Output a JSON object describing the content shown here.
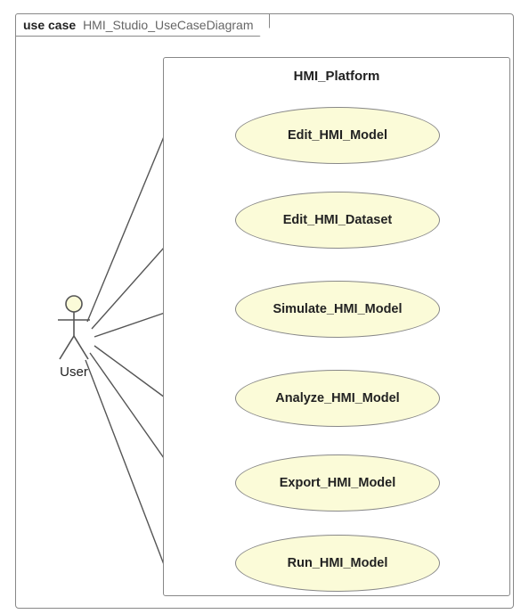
{
  "frame": {
    "keyword": "use case",
    "name": "HMI_Studio_UseCaseDiagram"
  },
  "system": {
    "name": "HMI_Platform"
  },
  "actor": {
    "name": "User"
  },
  "usecases": [
    {
      "label": "Edit_HMI_Model"
    },
    {
      "label": "Edit_HMI_Dataset"
    },
    {
      "label": "Simulate_HMI_Model"
    },
    {
      "label": "Analyze_HMI_Model"
    },
    {
      "label": "Export_HMI_Model"
    },
    {
      "label": "Run_HMI_Model"
    }
  ]
}
